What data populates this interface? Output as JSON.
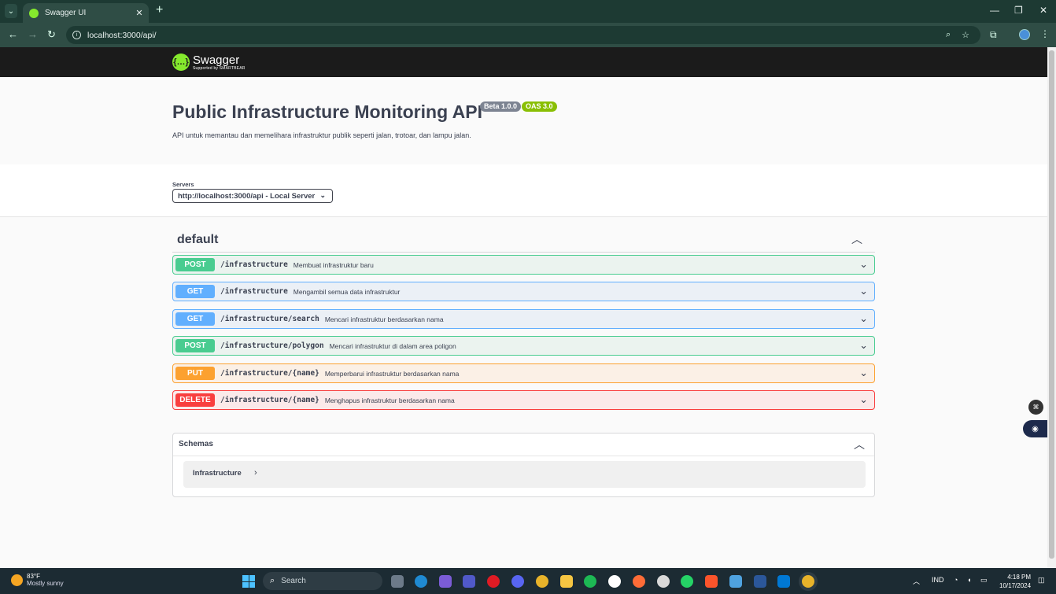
{
  "browser": {
    "tab_title": "Swagger UI",
    "url": "localhost:3000/api/",
    "new_tab_symbol": "+",
    "icons": [
      "back-icon",
      "forward-icon",
      "reload-icon",
      "zoom-icon",
      "star-icon",
      "extensions-icon",
      "profile-icon",
      "menu-icon"
    ]
  },
  "swagger": {
    "brand": "Swagger",
    "brand_sub": "Supported by SMARTBEAR",
    "logo_glyph": "{…}"
  },
  "api": {
    "title": "Public Infrastructure Monitoring API",
    "version_badge": "Beta 1.0.0",
    "oas_badge": "OAS 3.0",
    "description": "API untuk memantau dan memelihara infrastruktur publik seperti jalan, trotoar, dan lampu jalan."
  },
  "servers": {
    "label": "Servers",
    "selected": "http://localhost:3000/api - Local Server"
  },
  "tag": {
    "name": "default"
  },
  "operations": [
    {
      "method": "POST",
      "path": "/infrastructure",
      "summary": "Membuat infrastruktur baru"
    },
    {
      "method": "GET",
      "path": "/infrastructure",
      "summary": "Mengambil semua data infrastruktur"
    },
    {
      "method": "GET",
      "path": "/infrastructure/search",
      "summary": "Mencari infrastruktur berdasarkan nama"
    },
    {
      "method": "POST",
      "path": "/infrastructure/polygon",
      "summary": "Mencari infrastruktur di dalam area poligon"
    },
    {
      "method": "PUT",
      "path": "/infrastructure/{name}",
      "summary": "Memperbarui infrastruktur berdasarkan nama"
    },
    {
      "method": "DELETE",
      "path": "/infrastructure/{name}",
      "summary": "Menghapus infrastruktur berdasarkan nama"
    }
  ],
  "schemas": {
    "title": "Schemas",
    "models": [
      "Infrastructure"
    ]
  },
  "colors": {
    "post": "#49cc90",
    "get": "#61affe",
    "put": "#fca130",
    "delete": "#f93e3e",
    "swagger_green": "#85ea2d"
  },
  "taskbar": {
    "weather_temp": "83°F",
    "weather_cond": "Mostly sunny",
    "search_label": "Search",
    "language": "IND",
    "time": "4:18 PM",
    "date": "10/17/2024"
  }
}
